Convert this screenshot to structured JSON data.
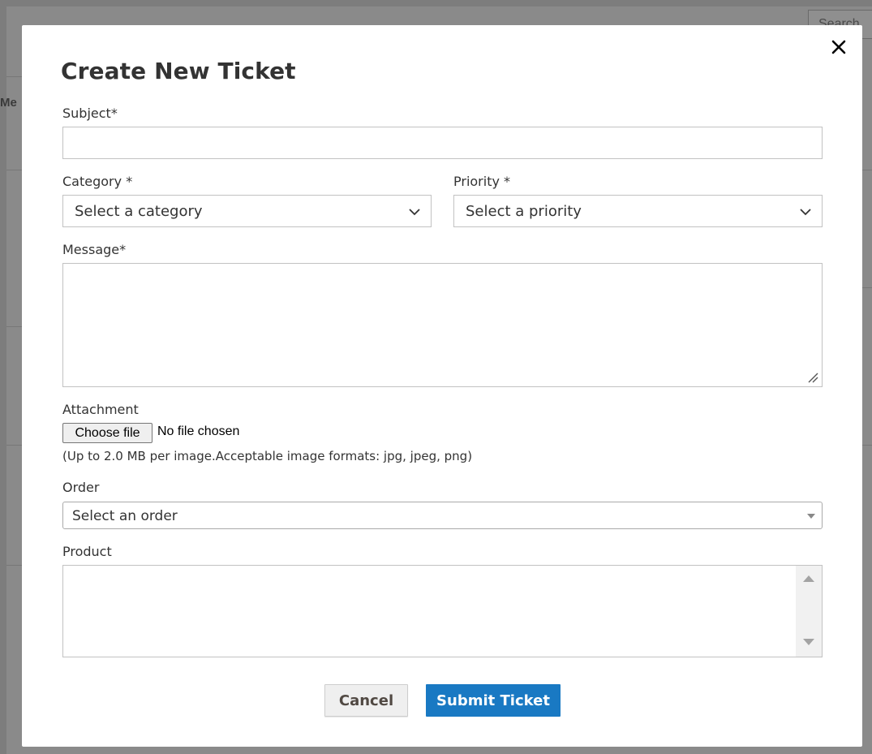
{
  "background": {
    "search_placeholder": "Search",
    "header_fragment": "Me"
  },
  "modal": {
    "title": "Create New Ticket",
    "close_icon": "close-icon",
    "subject": {
      "label": "Subject",
      "required_mark": "*",
      "value": ""
    },
    "category": {
      "label": "Category",
      "required_mark": "*",
      "selected": "Select a category"
    },
    "priority": {
      "label": "Priority",
      "required_mark": "*",
      "selected": "Select a priority"
    },
    "message": {
      "label": "Message",
      "required_mark": "*",
      "value": ""
    },
    "attachment": {
      "label": "Attachment",
      "button_label": "Choose file",
      "status": "No file chosen",
      "hint": "(Up to 2.0 MB per image.Acceptable image formats: jpg, jpeg, png)"
    },
    "order": {
      "label": "Order",
      "selected": "Select an order"
    },
    "product": {
      "label": "Product",
      "options": []
    },
    "buttons": {
      "cancel": "Cancel",
      "submit": "Submit Ticket"
    }
  },
  "colors": {
    "primary": "#1979c3",
    "backdrop": "#8a8a8a",
    "text": "#333333"
  }
}
